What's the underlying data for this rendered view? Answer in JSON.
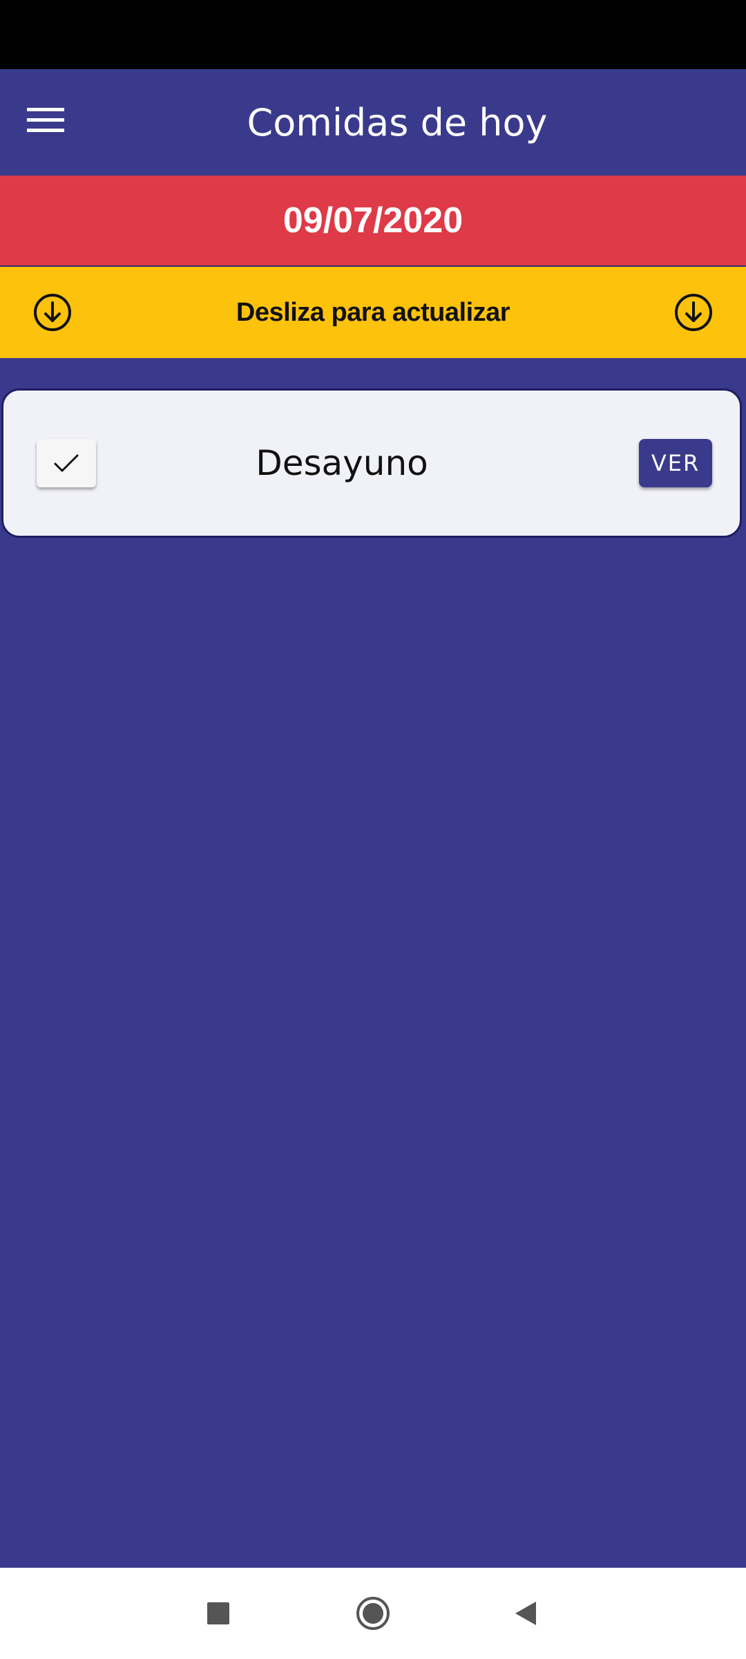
{
  "app_bar": {
    "title": "Comidas de hoy",
    "menu_icon": "hamburger-menu-icon"
  },
  "date_banner": {
    "date": "09/07/2020"
  },
  "refresh_hint": {
    "label": "Desliza para actualizar",
    "icon": "arrow-down-circle-icon"
  },
  "meals": [
    {
      "name": "Desayuno",
      "checked": true,
      "action_label": "VER"
    }
  ],
  "nav_bar": {
    "buttons": [
      "recents-icon",
      "home-icon",
      "back-icon"
    ]
  },
  "colors": {
    "primary": "#3a3a8c",
    "date_banner": "#de3a47",
    "refresh_bar": "#fdc20b",
    "card_bg": "#f1f2f8"
  }
}
